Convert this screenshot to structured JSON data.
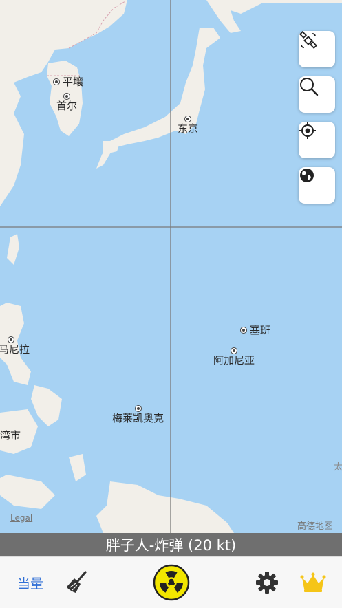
{
  "map": {
    "cities": [
      {
        "name": "平壤"
      },
      {
        "name": "首尔"
      },
      {
        "name": "东京"
      },
      {
        "name": "马尼拉",
        "display": "马尼拉"
      },
      {
        "name": "塞班"
      },
      {
        "name": "阿加尼亚"
      },
      {
        "name": "梅莱凯奥克"
      },
      {
        "name": "湾市"
      }
    ],
    "legal_label": "Legal",
    "provider_label": "高德地图",
    "edge_label": "太"
  },
  "controls": {
    "satellite_icon": "satellite-icon",
    "search_icon": "search-icon",
    "locate_icon": "locate-icon",
    "globe_icon": "globe-icon"
  },
  "banner": {
    "text": "胖子人-炸弹 (20 kt)"
  },
  "tabbar": {
    "yield_label": "当量",
    "accent_color": "#2f6fd6",
    "crown_color": "#f5c518"
  }
}
